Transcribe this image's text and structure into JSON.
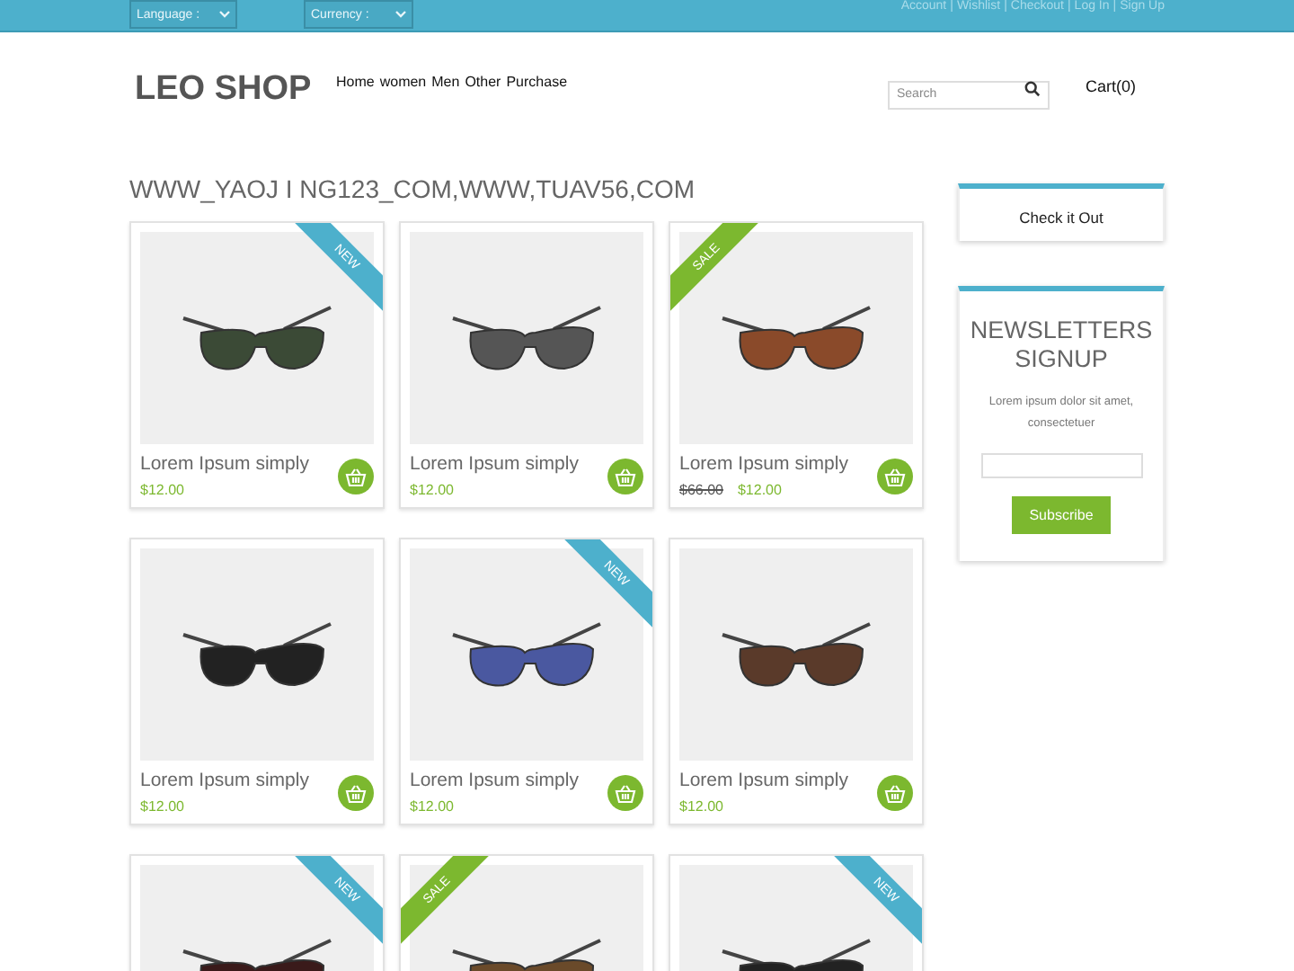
{
  "topbar": {
    "language": "Language :",
    "currency": "Currency :",
    "separator": "|",
    "links": [
      "Account",
      "Wishlist",
      "Checkout",
      "Log In",
      "Sign Up"
    ]
  },
  "header": {
    "logo": "LEO SHOP",
    "nav": [
      "Home",
      "women",
      "Men",
      "Other",
      "Purchase"
    ],
    "search": {
      "placeholder": "Search"
    },
    "cart": "Cart(0)"
  },
  "title": "WWW_YAOJ I NG123_COM,WWW,TUAV56,COM",
  "products": [
    {
      "badge": "NEW",
      "kind": "new",
      "name": "Lorem Ipsum simply",
      "price": "$12.00"
    },
    {
      "name": "Lorem Ipsum simply",
      "price": "$12.00"
    },
    {
      "badge": "SALE",
      "kind": "sale",
      "name": "Lorem Ipsum simply",
      "old_price": "$66.00",
      "price": "$12.00"
    },
    {
      "name": "Lorem Ipsum simply",
      "price": "$12.00"
    },
    {
      "badge": "NEW",
      "kind": "new",
      "name": "Lorem Ipsum simply",
      "price": "$12.00"
    },
    {
      "name": "Lorem Ipsum simply",
      "price": "$12.00"
    },
    {
      "badge": "NEW",
      "kind": "new"
    },
    {
      "badge": "SALE",
      "kind": "sale"
    },
    {
      "badge": "NEW",
      "kind": "new"
    }
  ],
  "sidebar": {
    "checkout": "Check it Out",
    "newsletter": {
      "title": "NEWSLETTERS SIGNUP",
      "text": "Lorem ipsum dolor sit amet, consectetuer",
      "button": "Subscribe"
    }
  }
}
